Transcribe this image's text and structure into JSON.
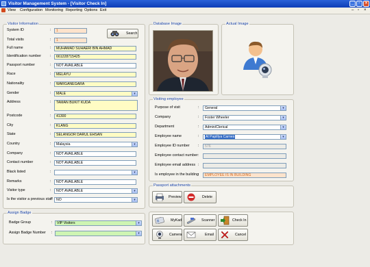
{
  "window": {
    "title": "Visitor Management System - [Visitor Check In]"
  },
  "menu": [
    "View",
    "Configuration",
    "Monitoring",
    "Reporting",
    "Options",
    "Exit"
  ],
  "visitor_info": {
    "title": "Visitor Information",
    "search_label": "Search",
    "fields": [
      {
        "label": "System ID",
        "value": "1",
        "style": "peach"
      },
      {
        "label": "Total visits",
        "value": "1",
        "style": "peach"
      },
      {
        "label": "Full name",
        "value": "MUHAMAD SUHAERI BIN AHMAD",
        "style": "yellow"
      },
      {
        "label": "Identification number",
        "value": "661228715425",
        "style": "yellow"
      },
      {
        "label": "Passport number",
        "value": "NOT AVAILABLE",
        "style": "white"
      },
      {
        "label": "Race",
        "value": "MELAYU",
        "style": "yellow"
      },
      {
        "label": "Nationality",
        "value": "WARGANEGARA",
        "style": "yellow"
      },
      {
        "label": "Gender",
        "value": "MALE",
        "style": "yellow",
        "combo": true
      },
      {
        "label": "Address",
        "value": "TAMAN BUKIT KUDA",
        "style": "yellow",
        "tall": true
      },
      {
        "label": "Postcode",
        "value": "41300",
        "style": "yellow"
      },
      {
        "label": "City",
        "value": "KLANG",
        "style": "yellow"
      },
      {
        "label": "State",
        "value": "SELANGOR DARUL EHSAN",
        "style": "yellow"
      },
      {
        "label": "Country",
        "value": "Malaysia",
        "style": "white",
        "combo": true
      },
      {
        "label": "Company",
        "value": "NOT AVAILABLE",
        "style": "white"
      },
      {
        "label": "Contact number",
        "value": "NOT AVAILABLE",
        "style": "white"
      },
      {
        "label": "Black listed",
        "value": "",
        "style": "white",
        "combo": true
      },
      {
        "label": "Remarks",
        "value": "NOT AVAILABLE",
        "style": "white"
      },
      {
        "label": "Visitor type",
        "value": "NOT AVAILABLE",
        "style": "white",
        "combo": true
      },
      {
        "label": "Is the visitor a previous staff",
        "value": "NO",
        "style": "white",
        "combo": true
      }
    ]
  },
  "badge": {
    "title": "Assign Badge",
    "group_label": "Badge Group",
    "group_value": "VIP Visitors",
    "number_label": "Assign Badge Number",
    "number_value": ""
  },
  "database_image": {
    "title": "Database Image"
  },
  "actual_image": {
    "title": "Actual Image"
  },
  "visiting": {
    "title": "Visiting employee",
    "fields": [
      {
        "label": "Purpose of visit",
        "value": "General",
        "style": "white",
        "combo": true
      },
      {
        "label": "Company",
        "value": "Foster Wheeler",
        "style": "white",
        "combo": true
      },
      {
        "label": "Department",
        "value": "Admin/Clerical",
        "style": "white",
        "combo": true
      },
      {
        "label": "Employee name",
        "value": "Al Papillya Carnes",
        "style": "sel",
        "combo": true
      },
      {
        "label": "Employee ID number",
        "value": "576",
        "style": "grey"
      },
      {
        "label": "Employee contact number",
        "value": "",
        "style": "grey"
      },
      {
        "label": "Employee email address",
        "value": "",
        "style": "grey"
      },
      {
        "label": "Is employee in the building",
        "value": "EMPLOYEE IS IN BUILDING",
        "style": "peach"
      }
    ]
  },
  "passport": {
    "title": "Passport attachments",
    "preview": "Preview",
    "delete": "Delete"
  },
  "actions": {
    "mykad": "MyKad",
    "scanner": "Scanner",
    "checkin": "Check In",
    "camera": "Camera",
    "email": "Email",
    "cancel": "Cancel"
  }
}
